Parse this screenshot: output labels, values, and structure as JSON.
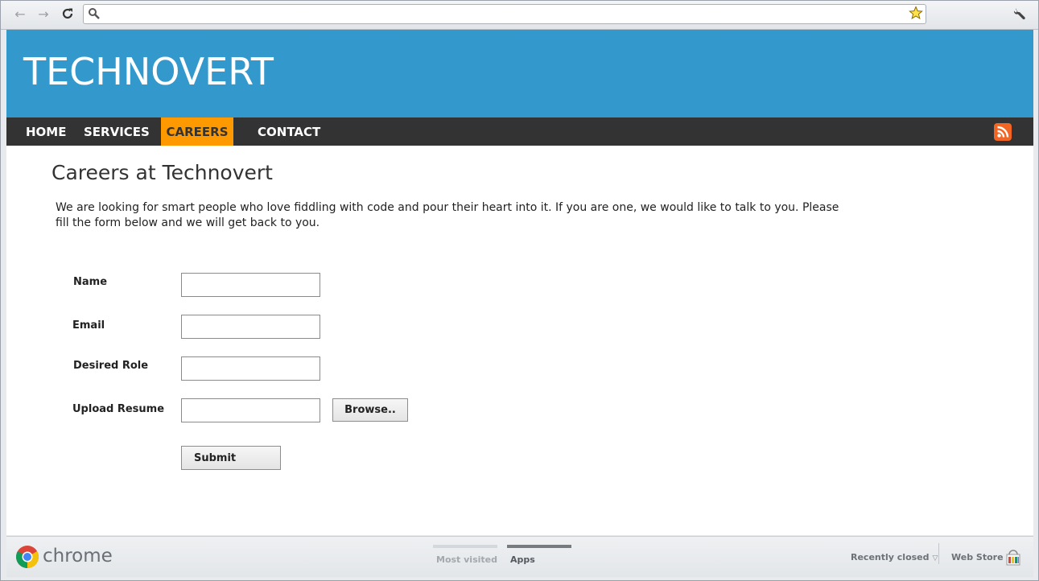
{
  "browser": {
    "omnibox_value": "",
    "nav": {
      "back": "←",
      "forward": "→",
      "reload": "↻"
    },
    "star_glyph": "☆",
    "accent_star": "#f2c200"
  },
  "site": {
    "logo": "TECHNOVERT",
    "header_color": "#3399cc",
    "nav_color": "#333333",
    "active_color": "#ff9900",
    "nav": {
      "home": "HOME",
      "services": "SERVICES",
      "careers": "CAREERS",
      "contact": "CONTACT",
      "active": "CAREERS"
    },
    "rss_icon": "rss-icon"
  },
  "page": {
    "title": "Careers at Technovert",
    "intro": "We are looking for smart people who love fiddling with code and pour their heart into it. If you are one, we would like to talk to you. Please fill the form below and we will get back to you."
  },
  "form": {
    "name_label": "Name",
    "name_value": "",
    "email_label": "Email",
    "email_value": "",
    "role_label": "Desired Role",
    "role_value": "",
    "resume_label": "Upload Resume",
    "resume_value": "",
    "browse_label": "Browse..",
    "submit_label": "Submit"
  },
  "bottom_bar": {
    "brand": "chrome",
    "tabs": {
      "most_visited": "Most visited",
      "apps": "Apps",
      "selected": "Apps"
    },
    "recently_closed": "Recently closed",
    "web_store": "Web Store"
  }
}
